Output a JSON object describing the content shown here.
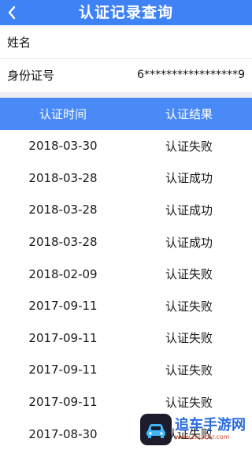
{
  "header": {
    "title": "认证记录查询",
    "back_icon": "chevron-left-icon"
  },
  "profile": {
    "name_label": "姓名",
    "name_value": "",
    "id_label": "身份证号",
    "id_value": "6*****************9"
  },
  "table": {
    "headers": {
      "time": "认证时间",
      "result": "认证结果"
    },
    "rows": [
      {
        "date": "2018-03-30",
        "result": "认证失败"
      },
      {
        "date": "2018-03-28",
        "result": "认证成功"
      },
      {
        "date": "2018-03-28",
        "result": "认证成功"
      },
      {
        "date": "2018-03-28",
        "result": "认证成功"
      },
      {
        "date": "2018-02-09",
        "result": "认证失败"
      },
      {
        "date": "2017-09-11",
        "result": "认证失败"
      },
      {
        "date": "2017-09-11",
        "result": "认证失败"
      },
      {
        "date": "2017-09-11",
        "result": "认证失败"
      },
      {
        "date": "2017-09-11",
        "result": "认证失败"
      },
      {
        "date": "2017-08-30",
        "result": "认证失败"
      }
    ]
  },
  "watermark": {
    "main": "追车手游网",
    "sub": "www.zhuicar.com"
  },
  "colors": {
    "primary": "#3f82f6",
    "table_header": "#4a8af7"
  }
}
